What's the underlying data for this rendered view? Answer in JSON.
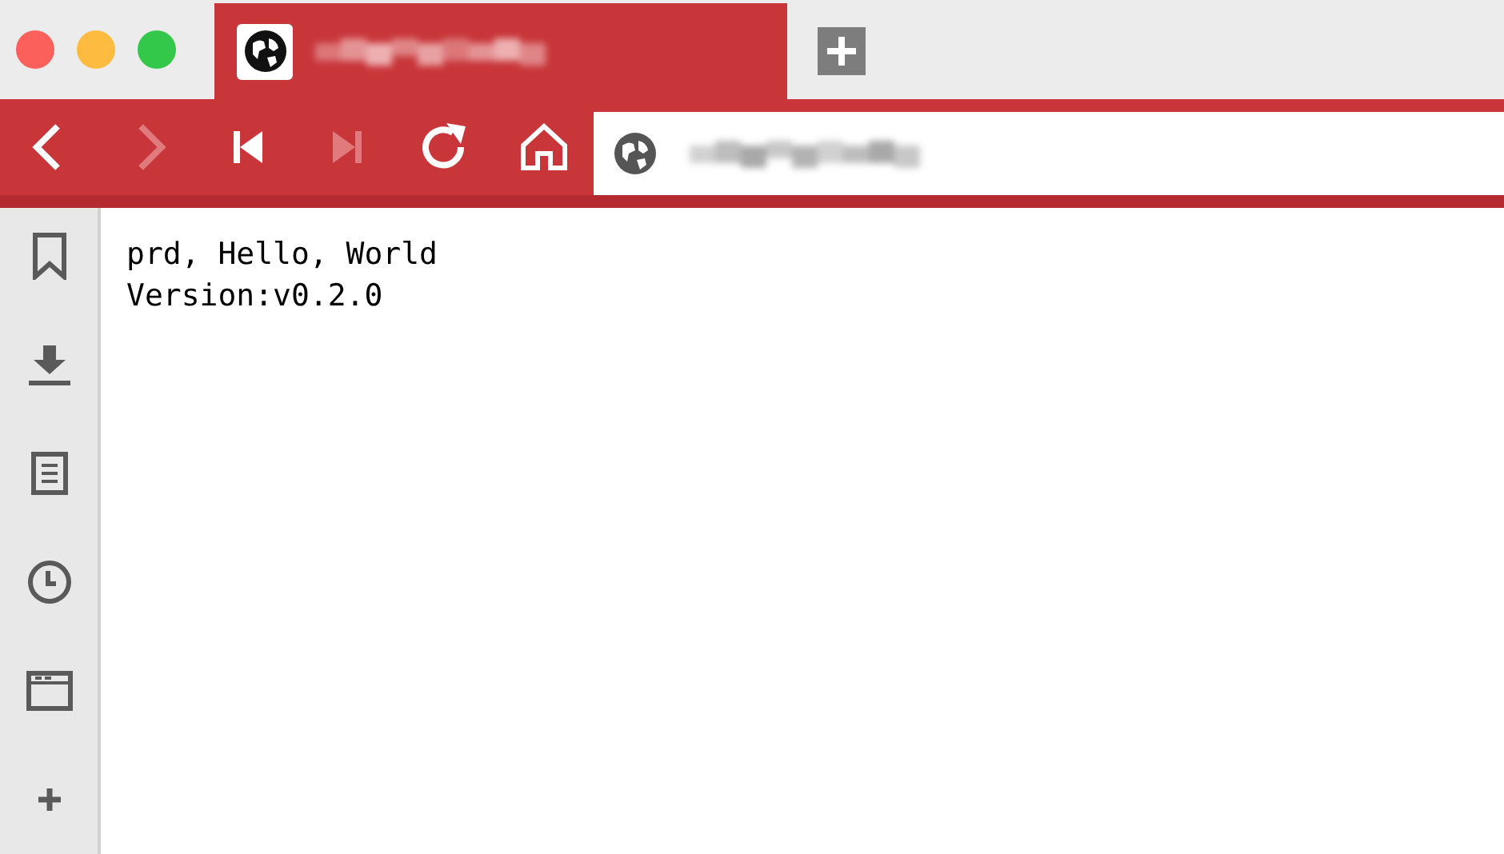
{
  "window_controls": [
    {
      "color": "#fc605b"
    },
    {
      "color": "#fdbc40"
    },
    {
      "color": "#34c84a"
    }
  ],
  "toolbar": [
    {
      "kind": "back",
      "disabled": false
    },
    {
      "kind": "forward",
      "disabled": true
    },
    {
      "kind": "first",
      "disabled": false
    },
    {
      "kind": "last",
      "disabled": true
    },
    {
      "kind": "reload",
      "disabled": false
    },
    {
      "kind": "home",
      "disabled": false
    }
  ],
  "sidebar": [
    {
      "kind": "bookmark"
    },
    {
      "kind": "download"
    },
    {
      "kind": "notes"
    },
    {
      "kind": "history"
    },
    {
      "kind": "window"
    },
    {
      "kind": "add"
    }
  ],
  "content": {
    "lines": [
      "prd, Hello, World",
      "Version:v0.2.0"
    ]
  }
}
